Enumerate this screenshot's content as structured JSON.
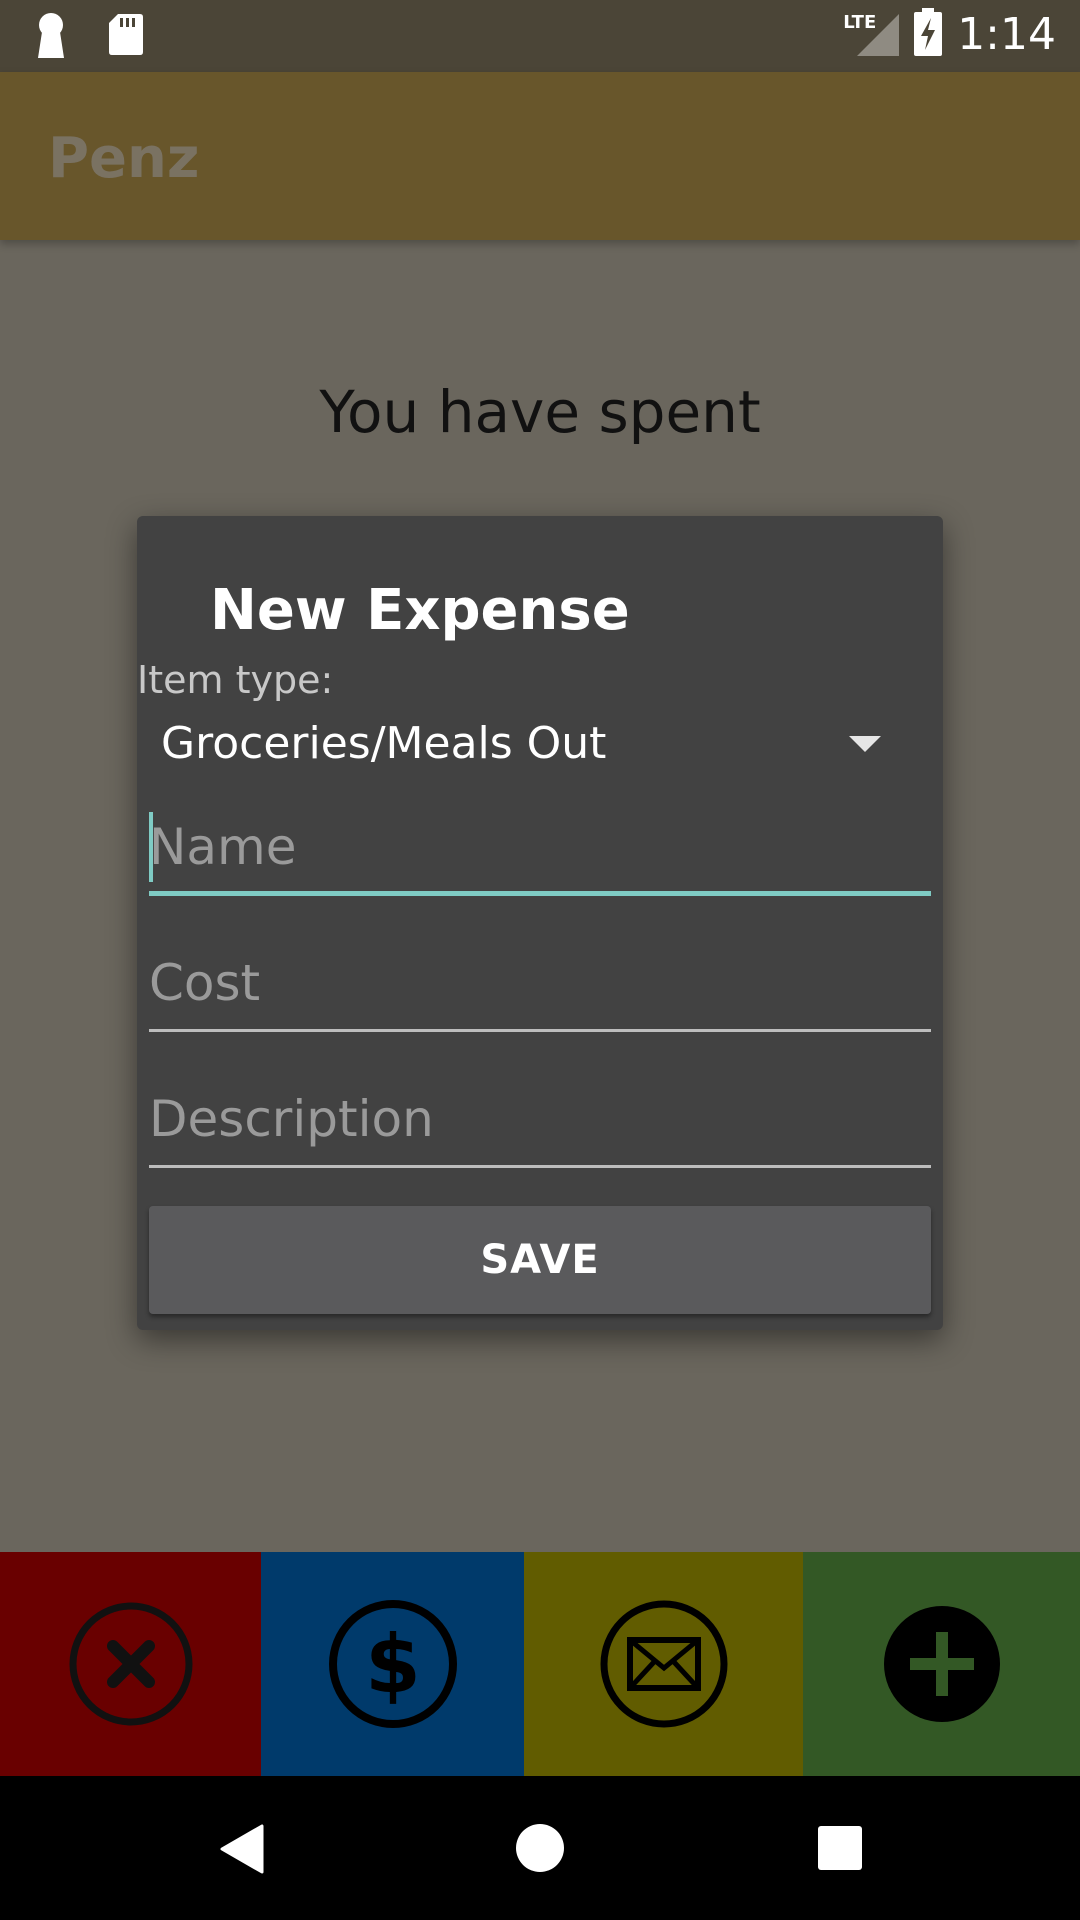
{
  "status_bar": {
    "network": "LTE",
    "time": "1:14"
  },
  "app_bar": {
    "title": "Penz"
  },
  "main": {
    "spent_label": "You have spent"
  },
  "dialog": {
    "title": "New Expense",
    "item_type_label": "Item type:",
    "item_type_selected": "Groceries/Meals Out",
    "name_placeholder": "Name",
    "cost_placeholder": "Cost",
    "description_placeholder": "Description",
    "save_label": "SAVE"
  },
  "bottom_actions": [
    {
      "icon": "close-icon",
      "color": "#690000"
    },
    {
      "icon": "dollar-icon",
      "color": "#003a6b"
    },
    {
      "icon": "mail-icon",
      "color": "#615c00"
    },
    {
      "icon": "add-icon",
      "color": "#335825"
    }
  ],
  "colors": {
    "accent": "#7fcbc4",
    "app_bar": "#68562b",
    "dialog_bg": "#424242"
  }
}
